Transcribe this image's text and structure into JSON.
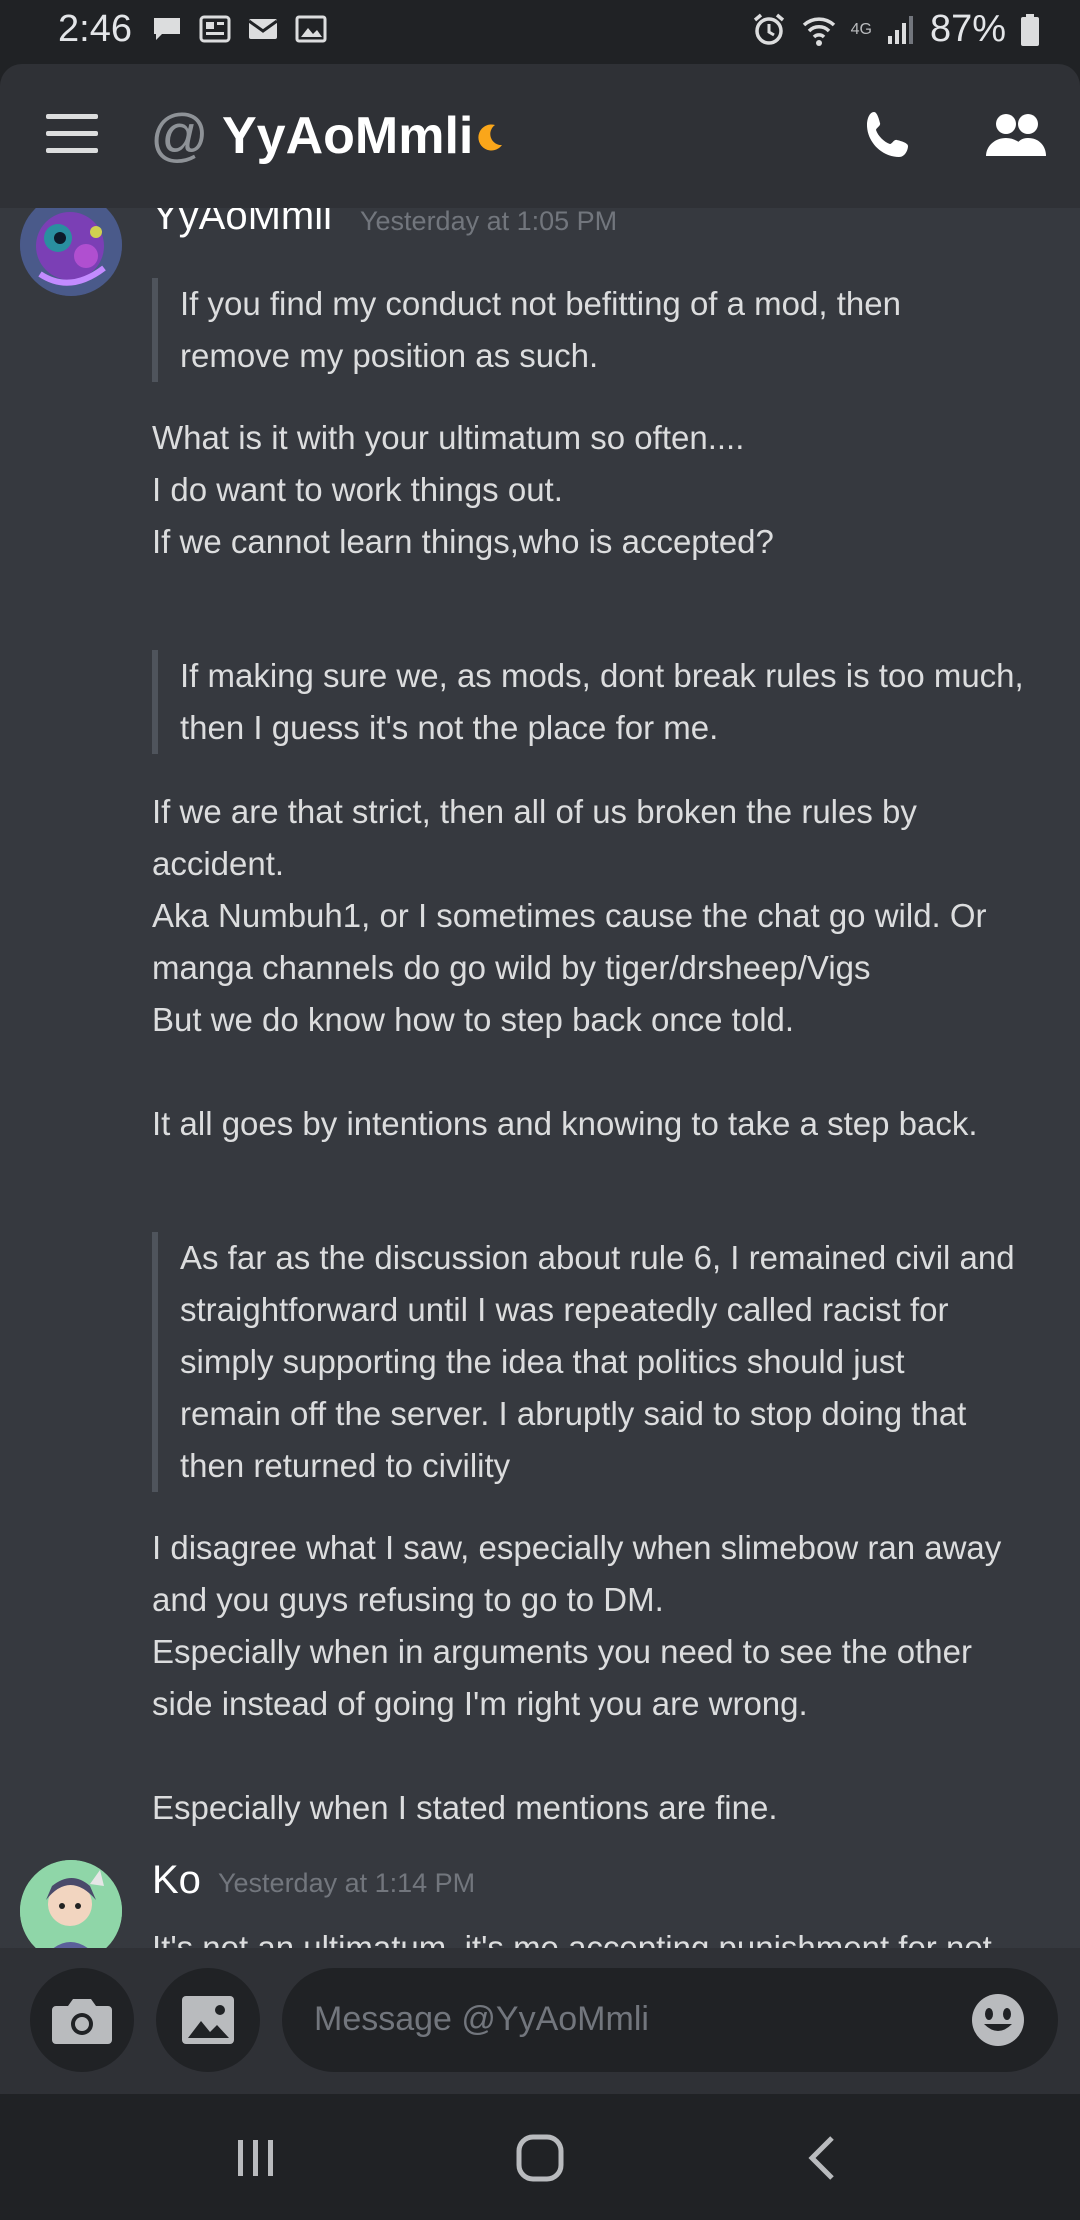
{
  "status_bar": {
    "time": "2:46",
    "network": "4G",
    "battery": "87%"
  },
  "header": {
    "at": "@",
    "title": "YyAoMmli"
  },
  "messages": [
    {
      "author": "YyAoMmli",
      "timestamp": "Yesterday at 1:05 PM",
      "quote1": [
        "If you find my conduct not befitting of a mod, then",
        "remove my position as such."
      ],
      "reply1": [
        "What is it with your ultimatum so often....",
        "I do want to work things out.",
        "If we cannot learn things,who is accepted?"
      ],
      "quote2": [
        "If making sure we, as mods, dont break rules is too much,",
        "then I guess it's not the place for me."
      ],
      "reply2": [
        "If we are that strict, then all of us broken the rules by",
        "accident.",
        "Aka Numbuh1, or I sometimes cause the chat go wild. Or",
        "manga channels do go wild by tiger/drsheep/Vigs",
        "But we do know how to step back once told.",
        "",
        "It all goes by intentions and knowing to take a step back."
      ],
      "quote3": [
        "As far as the discussion about rule 6, I remained civil and",
        "straightforward until I was repeatedly called racist for",
        "simply supporting the idea that politics should just",
        "remain off the server. I abruptly said to stop doing that",
        "then returned to civility"
      ],
      "reply3": [
        "I disagree what I saw, especially when slimebow ran away",
        "and you guys refusing to go to DM.",
        "Especially when in arguments you need to see the other",
        "side instead of going I'm right you are wrong.",
        "",
        "Especially when I stated mentions are fine."
      ]
    },
    {
      "author": "Ko",
      "timestamp": "Yesterday at 1:14 PM",
      "text": "It's not an ultimatum, it's me accepting punishment for not"
    }
  ],
  "input": {
    "placeholder": "Message @YyAoMmli"
  },
  "colors": {
    "background": "#36393f",
    "header": "#2f3136",
    "dark": "#202225",
    "text": "#dcddde",
    "muted": "#72767d",
    "moon": "#faa61a"
  }
}
